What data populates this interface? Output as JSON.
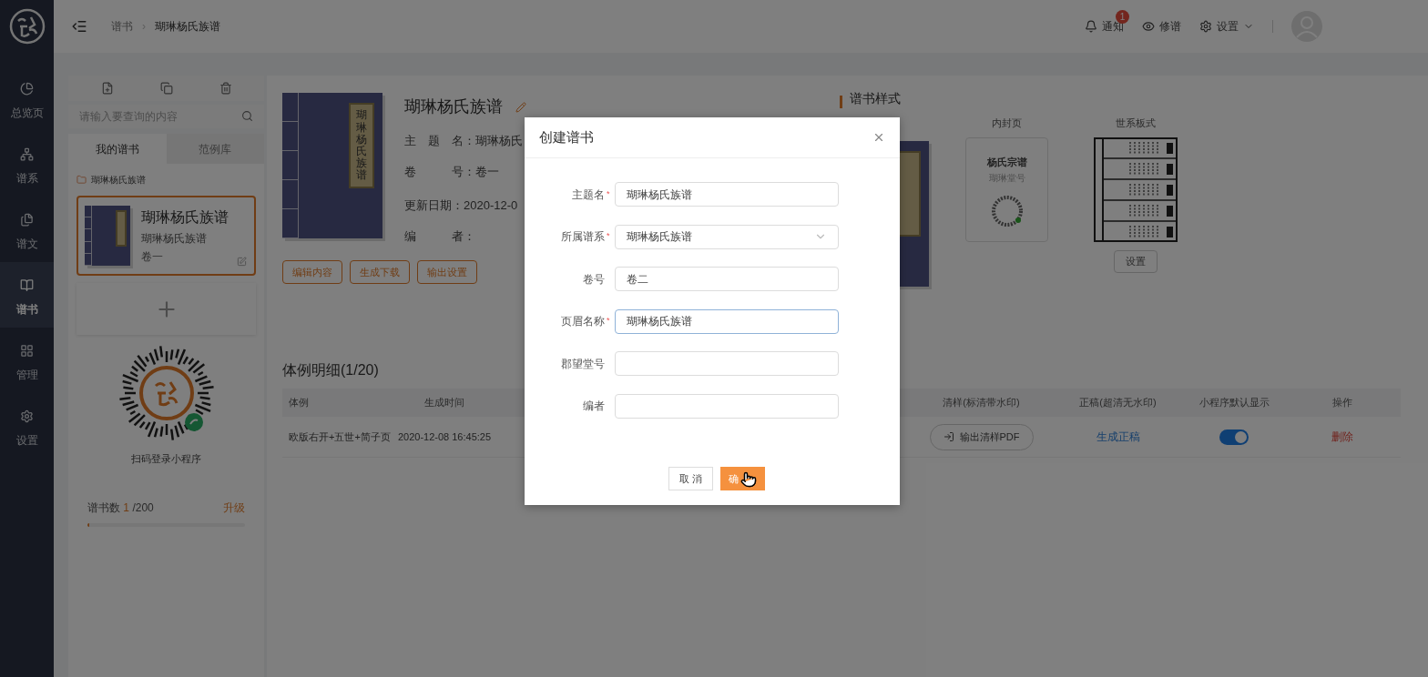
{
  "sidebar": {
    "items": [
      {
        "label": "总览页",
        "selected": false
      },
      {
        "label": "谱系",
        "selected": false
      },
      {
        "label": "谱文",
        "selected": false
      },
      {
        "label": "谱书",
        "selected": true
      },
      {
        "label": "管理",
        "selected": false
      },
      {
        "label": "设置",
        "selected": false
      }
    ]
  },
  "header": {
    "breadcrumb": [
      "谱书",
      "瑚琳杨氏族谱"
    ],
    "breadcrumb_separator": "›",
    "actions": [
      {
        "label": "通知",
        "badge": "1"
      },
      {
        "label": "修谱"
      },
      {
        "label": "设置",
        "dropdown": true
      }
    ]
  },
  "library": {
    "search": {
      "placeholder": "请输入要查询的内容"
    },
    "tabs": [
      {
        "label": "我的谱书",
        "selected": true
      },
      {
        "label": "范例库",
        "selected": false
      }
    ],
    "folder": "瑚琳杨氏族谱",
    "books": [
      {
        "title": "瑚琳杨氏族谱",
        "subtitle": "瑚琳杨氏族谱",
        "volume": "卷一",
        "selected": true
      }
    ],
    "qr_caption": "扫码登录小程序",
    "quota": {
      "label": "谱书数",
      "used": "1",
      "total": "/200",
      "upgrade": "升级",
      "level": 0.01
    }
  },
  "book": {
    "cover_label": "瑚琳杨氏族谱",
    "title": "瑚琳杨氏族谱",
    "fields": [
      {
        "label": "主　题　名：",
        "value": "瑚琳杨氏"
      },
      {
        "label": "卷　　　号：",
        "value": "卷一"
      },
      {
        "label": "更新日期：",
        "value": "2020-12-0"
      },
      {
        "label": "编　　　者："
      }
    ],
    "buttons": [
      "编辑内容",
      "生成下载",
      "输出设置"
    ]
  },
  "styles": {
    "title": "谱书样式",
    "items": [
      {
        "kind": "cover"
      },
      {
        "kind": "inner",
        "label": "内封页",
        "heading": "杨氏宗谱",
        "subheading": "瑚琳堂号"
      },
      {
        "kind": "layout",
        "label": "世系板式",
        "button": "设置"
      }
    ]
  },
  "table": {
    "title": "体例明细(1/20)",
    "columns": [
      "体例",
      "生成时间",
      "清样(标清带水印)",
      "正稿(超清无水印)",
      "小程序默认显示",
      "操作"
    ],
    "rows": [
      {
        "style": "欧版右开+五世+简子页",
        "time": "2020-12-08 16:45:25",
        "proof_button": "输出清样PDF",
        "final_link": "生成正稿",
        "default_on": true,
        "delete": "删除"
      }
    ]
  },
  "dialog": {
    "title": "创建谱书",
    "required_mark": "*",
    "fields": [
      {
        "label": "主题名",
        "required": true,
        "kind": "text",
        "value": "瑚琳杨氏族谱",
        "focused": false
      },
      {
        "label": "所属谱系",
        "required": true,
        "kind": "select",
        "value": "瑚琳杨氏族谱",
        "focused": false
      },
      {
        "label": "卷号",
        "required": false,
        "kind": "text",
        "value": "卷二",
        "focused": false
      },
      {
        "label": "页眉名称",
        "required": true,
        "kind": "text",
        "value": "瑚琳杨氏族谱",
        "focused": true
      },
      {
        "label": "郡望堂号",
        "required": false,
        "kind": "text",
        "focused": false
      },
      {
        "label": "编者",
        "required": false,
        "kind": "text",
        "focused": false
      }
    ],
    "cancel": "取 消",
    "confirm": "确"
  }
}
